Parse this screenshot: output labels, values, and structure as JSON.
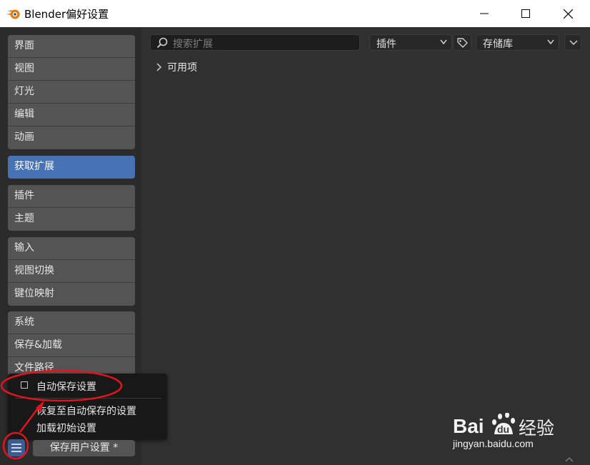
{
  "window": {
    "title": "Blender偏好设置",
    "minimize_glyph": "—",
    "maximize_glyph": "☐",
    "close_glyph": "✕"
  },
  "sidebar": {
    "groups": [
      {
        "items": [
          {
            "label": "界面"
          },
          {
            "label": "视图"
          },
          {
            "label": "灯光"
          },
          {
            "label": "编辑"
          },
          {
            "label": "动画"
          }
        ]
      },
      {
        "items": [
          {
            "label": "获取扩展",
            "active": true
          }
        ]
      },
      {
        "items": [
          {
            "label": "插件"
          },
          {
            "label": "主题"
          }
        ]
      },
      {
        "items": [
          {
            "label": "输入"
          },
          {
            "label": "视图切换"
          },
          {
            "label": "键位映射"
          }
        ]
      },
      {
        "items": [
          {
            "label": "系统"
          },
          {
            "label": "保存&加载"
          },
          {
            "label": "文件路径"
          }
        ]
      }
    ]
  },
  "toolbar": {
    "search_placeholder": "搜索扩展",
    "type_dropdown": "插件",
    "repo_dropdown": "存储库"
  },
  "main": {
    "section_available": "可用项"
  },
  "popup": {
    "autosave_label": "自动保存设置",
    "revert_label": "恢复至自动保存的设置",
    "load_factory_label": "加载初始设置"
  },
  "footer": {
    "save_button": "保存用户设置 *"
  },
  "watermark": {
    "brand": "Baidu经验",
    "url": "jingyan.baidu.com"
  },
  "colors": {
    "active": "#4772b3",
    "annotation": "#e0141e"
  }
}
